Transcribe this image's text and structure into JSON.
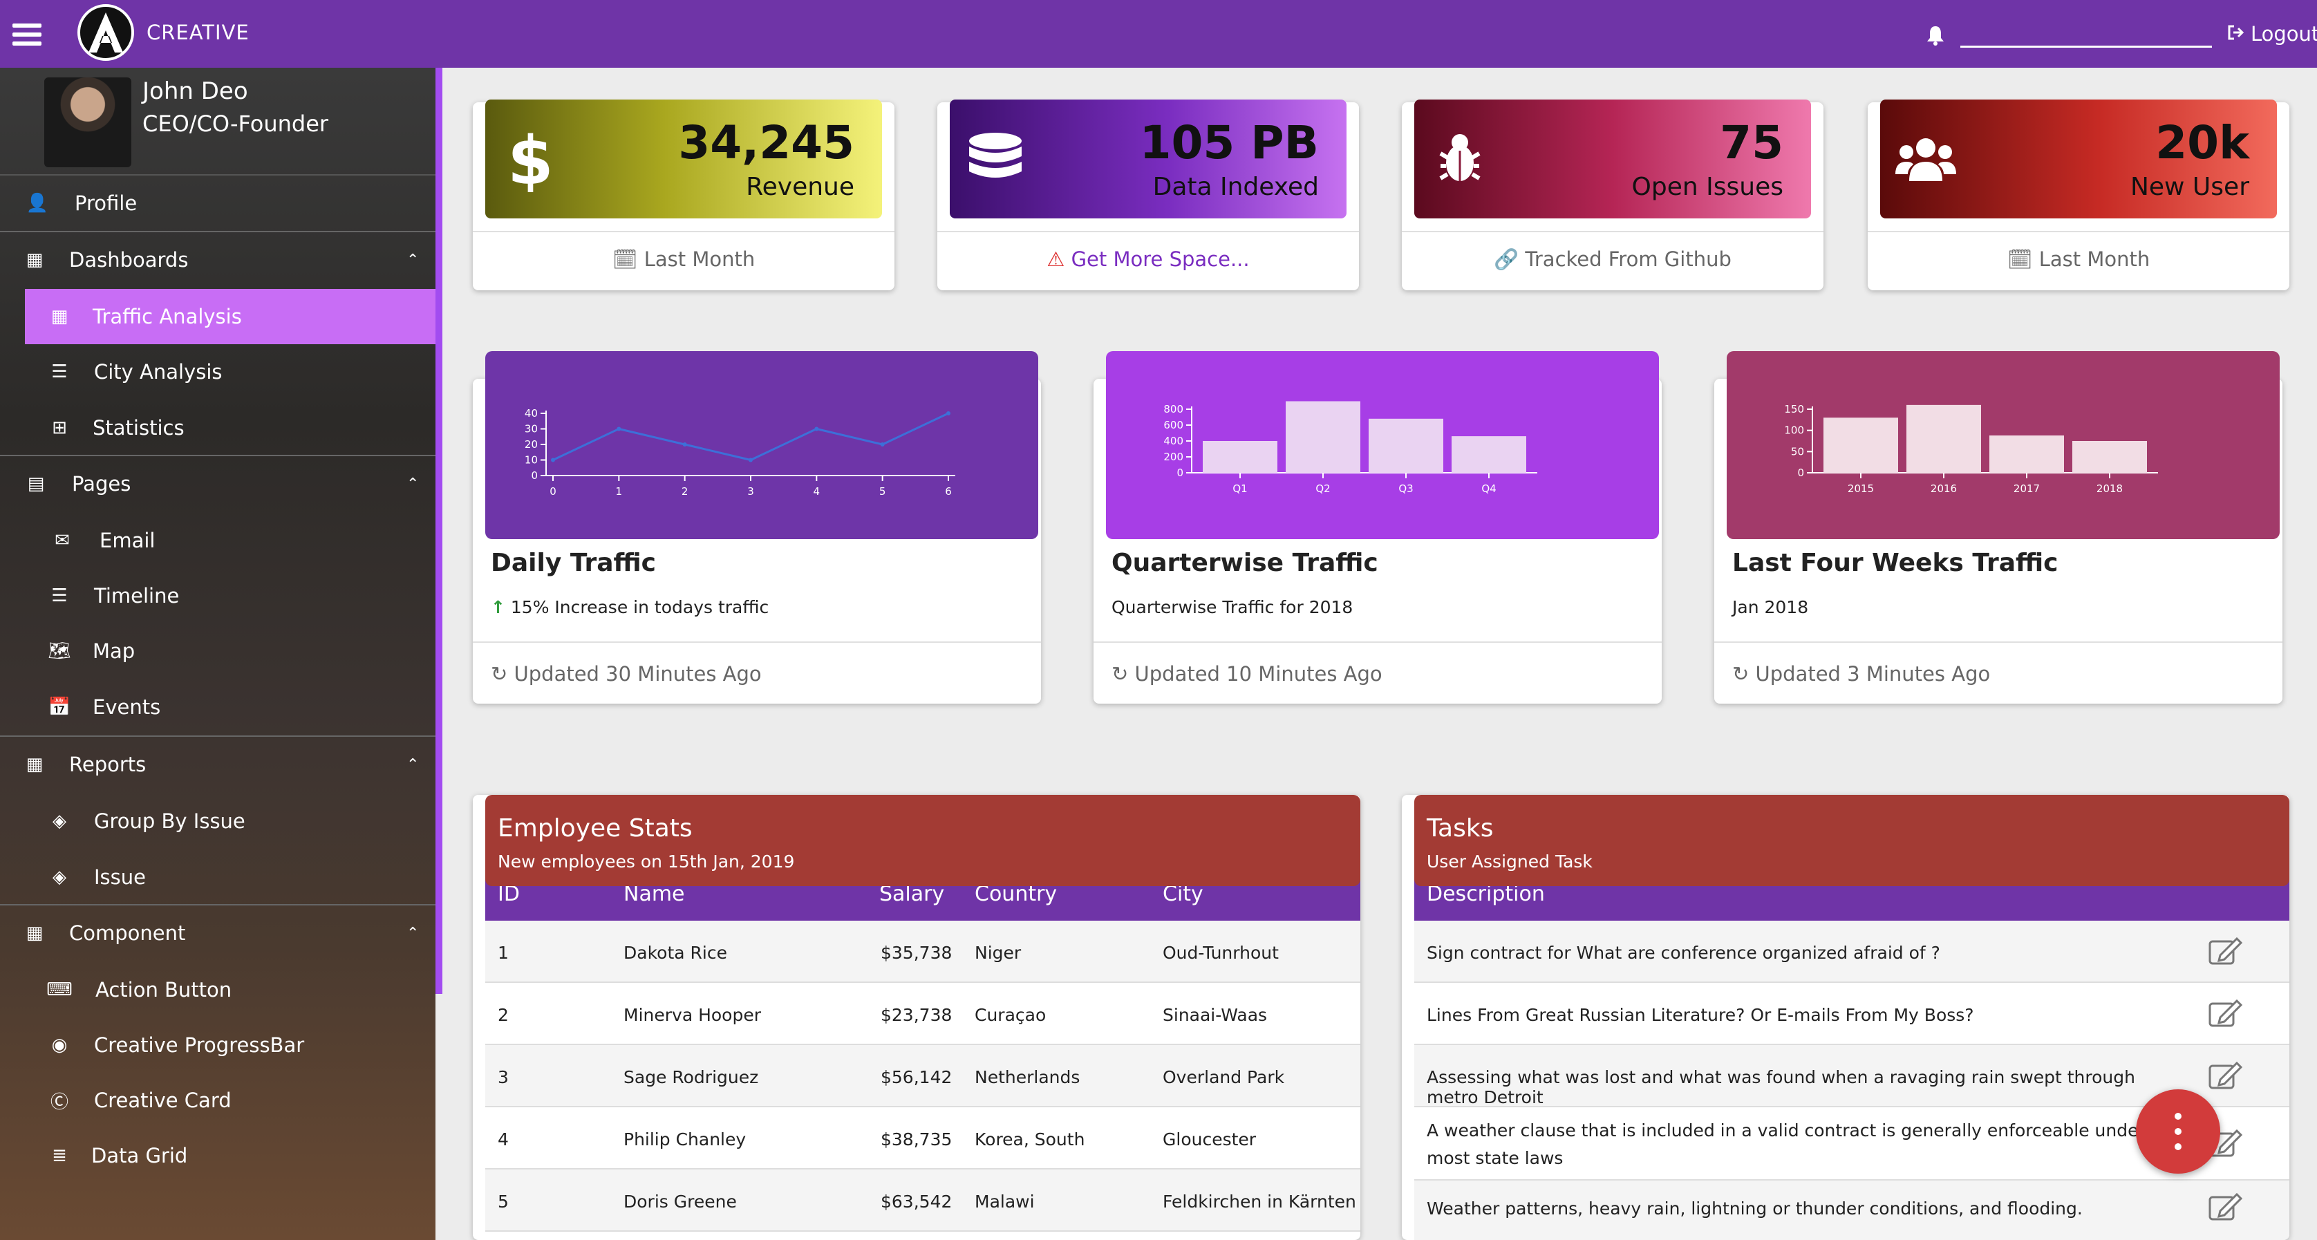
{
  "header": {
    "brand": "CREATIVE",
    "logout_label": "Logout"
  },
  "profile": {
    "name": "John Deo",
    "role": "CEO/CO-Founder"
  },
  "sidebar": {
    "profile": "Profile",
    "dashboards": "Dashboards",
    "traffic_analysis": "Traffic Analysis",
    "city_analysis": "City Analysis",
    "statistics": "Statistics",
    "pages": "Pages",
    "email": "Email",
    "timeline": "Timeline",
    "map": "Map",
    "events": "Events",
    "reports": "Reports",
    "group_by_issue": "Group By Issue",
    "issue": "Issue",
    "component": "Component",
    "action_button": "Action Button",
    "creative_progressbar": "Creative ProgressBar",
    "creative_card": "Creative Card",
    "data_grid": "Data Grid"
  },
  "stats": [
    {
      "value": "34,245",
      "label": "Revenue",
      "footer": "Last Month",
      "icon": "dollar-icon"
    },
    {
      "value": "105 PB",
      "label": "Data Indexed",
      "footer": "Get More Space...",
      "icon": "database-icon"
    },
    {
      "value": "75",
      "label": "Open Issues",
      "footer": "Tracked From Github",
      "icon": "bug-icon"
    },
    {
      "value": "20k",
      "label": "New User",
      "footer": "Last Month",
      "icon": "users-icon"
    }
  ],
  "cards": [
    {
      "title": "Daily Traffic",
      "desc": "15% Increase in todays traffic",
      "updated": "Updated 30 Minutes Ago"
    },
    {
      "title": "Quarterwise Traffic",
      "desc": "Quarterwise Traffic for 2018",
      "updated": "Updated 10 Minutes Ago"
    },
    {
      "title": "Last Four Weeks Traffic",
      "desc": "Jan 2018",
      "updated": "Updated 3 Minutes Ago"
    }
  ],
  "chart_data": [
    {
      "type": "line",
      "x": [
        0,
        1,
        2,
        3,
        4,
        5,
        6
      ],
      "values": [
        10,
        30,
        20,
        10,
        30,
        20,
        40
      ],
      "ylim": [
        0,
        40
      ],
      "yticks": [
        0,
        10,
        20,
        30,
        40
      ],
      "color": "#3d6fd8"
    },
    {
      "type": "bar",
      "categories": [
        "Q1",
        "Q2",
        "Q3",
        "Q4"
      ],
      "values": [
        400,
        900,
        680,
        460
      ],
      "ylim": [
        0,
        800
      ],
      "yticks": [
        0,
        200,
        400,
        600,
        800
      ],
      "color": "#ead3f2"
    },
    {
      "type": "bar",
      "categories": [
        "2015",
        "2016",
        "2017",
        "2018"
      ],
      "values": [
        130,
        160,
        88,
        75
      ],
      "ylim": [
        0,
        150
      ],
      "yticks": [
        0,
        50,
        100,
        150
      ],
      "color": "#f2dde5"
    }
  ],
  "employee": {
    "title": "Employee Stats",
    "subtitle": "New employees on 15th Jan, 2019",
    "columns": [
      "ID",
      "Name",
      "Salary",
      "Country",
      "City"
    ],
    "rows": [
      [
        "1",
        "Dakota Rice",
        "$35,738",
        "Niger",
        "Oud-Tunrhout"
      ],
      [
        "2",
        "Minerva Hooper",
        "$23,738",
        "Curaçao",
        "Sinaai-Waas"
      ],
      [
        "3",
        "Sage Rodriguez",
        "$56,142",
        "Netherlands",
        "Overland Park"
      ],
      [
        "4",
        "Philip Chanley",
        "$38,735",
        "Korea, South",
        "Gloucester"
      ],
      [
        "5",
        "Doris Greene",
        "$63,542",
        "Malawi",
        "Feldkirchen in Kärnten"
      ]
    ]
  },
  "tasks": {
    "title": "Tasks",
    "subtitle": "User Assigned Task",
    "column": "Description",
    "items": [
      "Sign contract for What are conference organized afraid of ?",
      "Lines From Great Russian Literature? Or E-mails From My Boss?",
      "Assessing what was lost and what was found when a ravaging rain swept through metro Detroit",
      "A weather clause that is included in a valid contract is generally enforceable under most state laws",
      "Weather patterns, heavy rain, lightning or thunder conditions, and flooding."
    ]
  },
  "colors": {
    "topbar": "#6f34a7",
    "sidebar_active": "#c86df5",
    "table_head": "#a33b34",
    "fab": "#d23b3b"
  }
}
